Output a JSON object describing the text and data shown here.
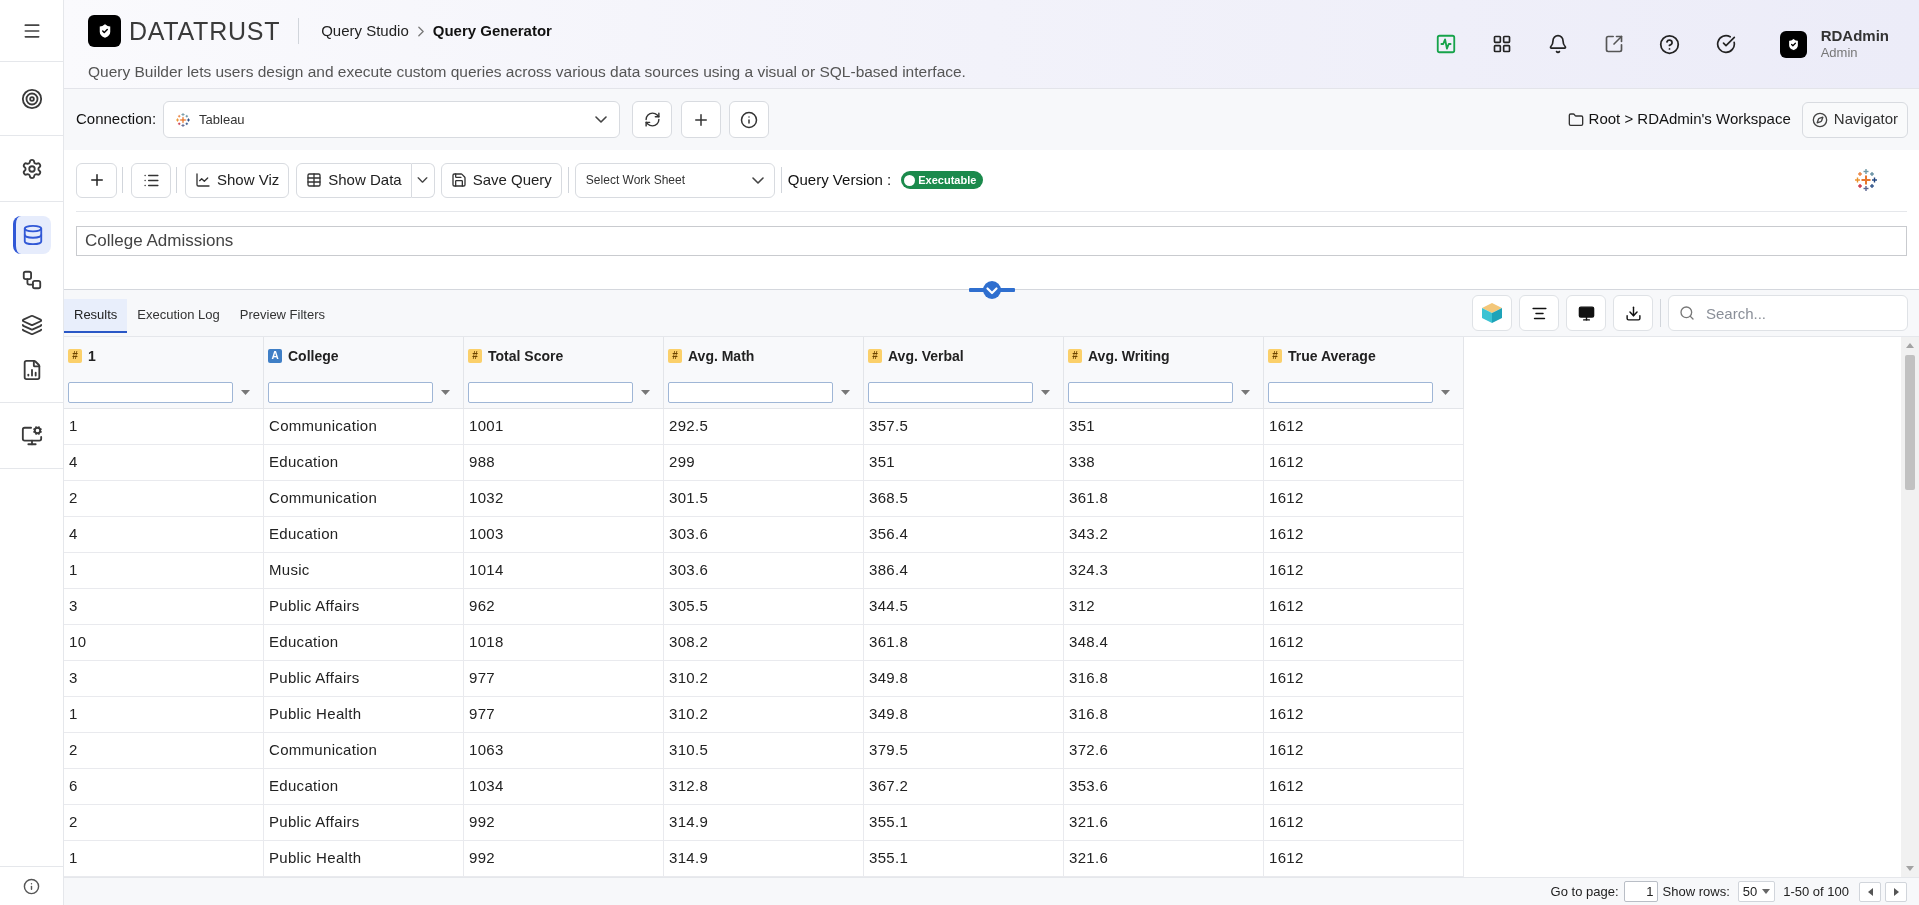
{
  "sidebar": {
    "groups": [
      [
        {
          "selected": false
        }
      ],
      [
        {
          "selected": false
        }
      ],
      [
        {
          "selected": true
        },
        {
          "selected": false
        },
        {
          "selected": false
        },
        {
          "selected": false
        }
      ],
      [
        {
          "selected": false
        }
      ]
    ]
  },
  "header": {
    "logo_text": "DATATRUST",
    "breadcrumb": [
      {
        "label": "Query Studio",
        "current": false
      },
      {
        "label": "Query Generator",
        "current": true
      }
    ],
    "description": "Query Builder lets users design and execute custom queries across various data sources using a visual or SQL-based interface.",
    "user": {
      "name": "RDAdmin",
      "role": "Admin"
    }
  },
  "connection": {
    "label": "Connection:",
    "value": "Tableau",
    "path": "Root > RDAdmin's Workspace",
    "navigator": "Navigator"
  },
  "toolbar": {
    "show_viz": "Show Viz",
    "show_data": "Show Data",
    "save_query": "Save Query",
    "worksheet": {
      "placeholder": "Select Work Sheet"
    },
    "version_label": "Query Version :",
    "version_status": "Executable"
  },
  "query_name": "College Admissions",
  "results": {
    "tabs": [
      {
        "label": "Results",
        "selected": true
      },
      {
        "label": "Execution Log",
        "selected": false
      },
      {
        "label": "Preview Filters",
        "selected": false
      }
    ],
    "search": {
      "placeholder": "Search..."
    },
    "columns": [
      {
        "label": "1",
        "type": "#",
        "kind": "number"
      },
      {
        "label": "College",
        "type": "A",
        "kind": "text"
      },
      {
        "label": "Total Score",
        "type": "#",
        "kind": "number"
      },
      {
        "label": "Avg. Math",
        "type": "#",
        "kind": "number"
      },
      {
        "label": "Avg. Verbal",
        "type": "#",
        "kind": "number"
      },
      {
        "label": "Avg. Writing",
        "type": "#",
        "kind": "number"
      },
      {
        "label": "True Average",
        "type": "#",
        "kind": "number"
      }
    ],
    "rows": [
      [
        "1",
        "Communication",
        "1001",
        "292.5",
        "357.5",
        "351",
        "1612"
      ],
      [
        "4",
        "Education",
        "988",
        "299",
        "351",
        "338",
        "1612"
      ],
      [
        "2",
        "Communication",
        "1032",
        "301.5",
        "368.5",
        "361.8",
        "1612"
      ],
      [
        "4",
        "Education",
        "1003",
        "303.6",
        "356.4",
        "343.2",
        "1612"
      ],
      [
        "1",
        "Music",
        "1014",
        "303.6",
        "386.4",
        "324.3",
        "1612"
      ],
      [
        "3",
        "Public Affairs",
        "962",
        "305.5",
        "344.5",
        "312",
        "1612"
      ],
      [
        "10",
        "Education",
        "1018",
        "308.2",
        "361.8",
        "348.4",
        "1612"
      ],
      [
        "3",
        "Public Affairs",
        "977",
        "310.2",
        "349.8",
        "316.8",
        "1612"
      ],
      [
        "1",
        "Public Health",
        "977",
        "310.2",
        "349.8",
        "316.8",
        "1612"
      ],
      [
        "2",
        "Communication",
        "1063",
        "310.5",
        "379.5",
        "372.6",
        "1612"
      ],
      [
        "6",
        "Education",
        "1034",
        "312.8",
        "367.2",
        "353.6",
        "1612"
      ],
      [
        "2",
        "Public Affairs",
        "992",
        "314.9",
        "355.1",
        "321.6",
        "1612"
      ],
      [
        "1",
        "Public Health",
        "992",
        "314.9",
        "355.1",
        "321.6",
        "1612"
      ]
    ],
    "pagination": {
      "go_to_label": "Go to page:",
      "page": "1",
      "rows_label": "Show rows:",
      "rows_per_page": "50",
      "range": "1-50 of 100"
    }
  }
}
